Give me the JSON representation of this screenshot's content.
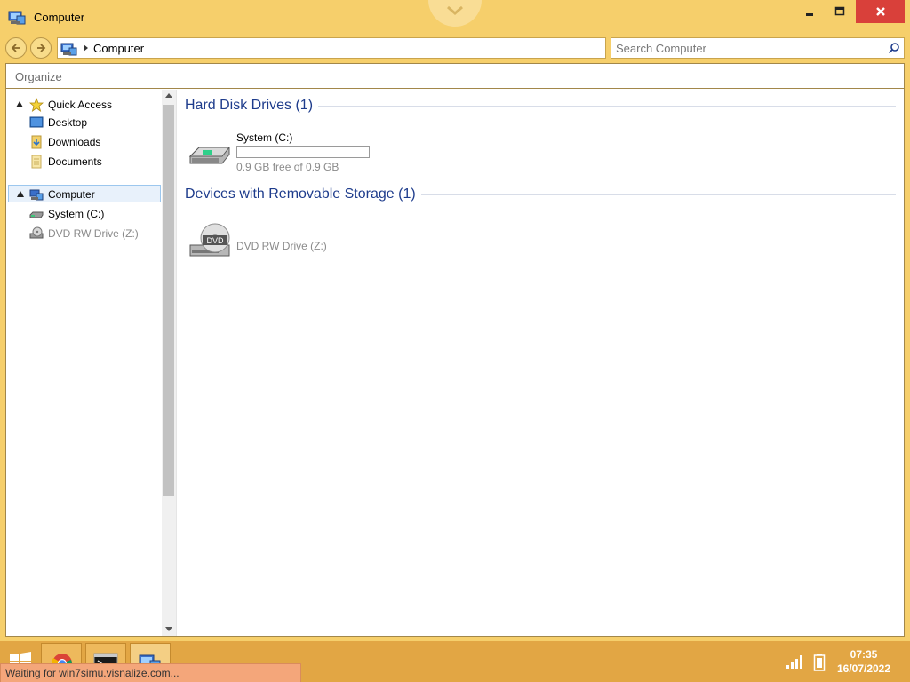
{
  "window": {
    "title": "Computer"
  },
  "address": {
    "path": "Computer"
  },
  "search": {
    "placeholder": "Search Computer"
  },
  "toolbar": {
    "organize_label": "Organize"
  },
  "nav": {
    "items": [
      {
        "label": "Quick Access",
        "icon": "star-icon"
      },
      {
        "label": "Desktop",
        "icon": "desktop-icon"
      },
      {
        "label": "Downloads",
        "icon": "downloads-icon"
      },
      {
        "label": "Documents",
        "icon": "documents-icon"
      },
      {
        "label": "Computer",
        "icon": "computer-icon"
      },
      {
        "label": "System (C:)",
        "icon": "hard-drive-icon"
      },
      {
        "label": "DVD RW Drive (Z:)",
        "icon": "dvd-drive-icon"
      }
    ]
  },
  "groups": [
    {
      "title": "Hard Disk Drives (1)",
      "drives": [
        {
          "name": "System (C:)",
          "free_text": "0.9 GB free of 0.9 GB",
          "used_fraction": 0.0
        }
      ]
    },
    {
      "title": "Devices with Removable Storage (1)",
      "drives": [
        {
          "name": "DVD RW Drive (Z:)",
          "disc_label": "DVD"
        }
      ]
    }
  ],
  "taskbar": {
    "apps": [
      "chrome-icon",
      "cmd-icon",
      "explorer-icon"
    ],
    "time": "07:35",
    "date": "16/07/2022"
  },
  "status": {
    "text": "Waiting for win7simu.visnalize.com..."
  },
  "colors": {
    "frame": "#f6cf6b",
    "taskbar": "#e2a644",
    "close_button": "#d9403a",
    "group_title": "#1e3c8c",
    "status_bar": "#f4a67a"
  }
}
